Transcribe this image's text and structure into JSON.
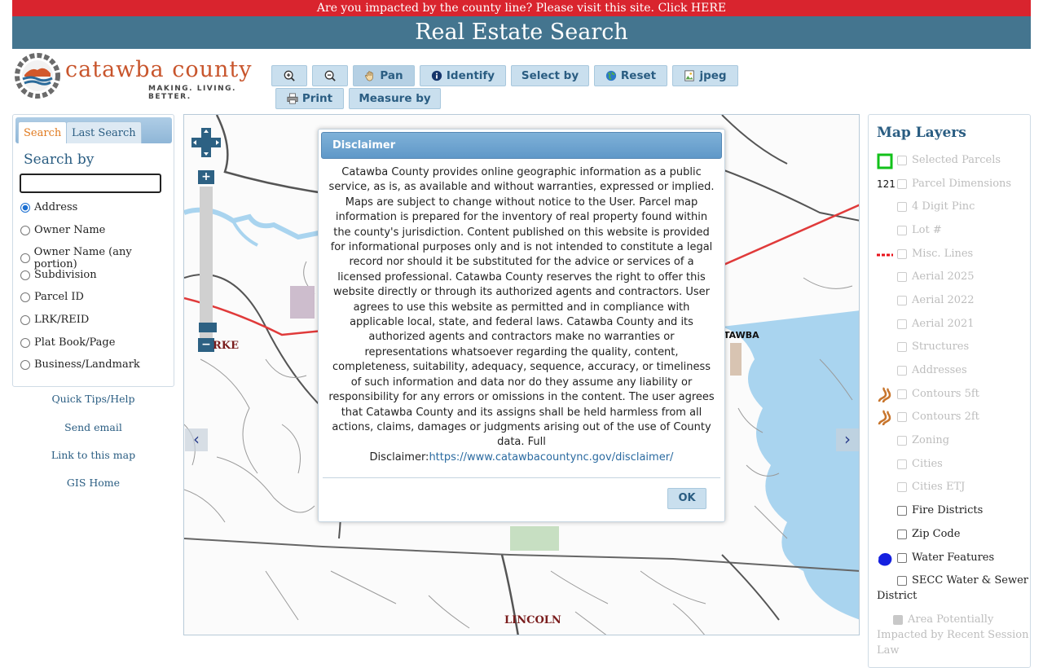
{
  "banner": {
    "text": "Are you impacted by the county line?   Please visit this site.   Click ",
    "link": "HERE"
  },
  "page_title": "Real Estate Search",
  "logo": {
    "name": "catawba county",
    "tagline": "MAKING. LIVING. BETTER."
  },
  "toolbar": {
    "zoom_in": "",
    "zoom_out": "",
    "pan": "Pan",
    "identify": "Identify",
    "select_by": "Select by",
    "reset": "Reset",
    "jpeg": "jpeg",
    "print": "Print",
    "measure_by": "Measure by"
  },
  "search_panel": {
    "tabs": [
      "Search",
      "Last Search"
    ],
    "heading": "Search by",
    "input_value": "",
    "options": [
      "Address",
      "Owner Name",
      "Owner Name (any portion)",
      "Subdivision",
      "Parcel ID",
      "LRK/REID",
      "Plat Book/Page",
      "Business/Landmark"
    ],
    "selected": "Address"
  },
  "links": [
    "Quick Tips/Help",
    "Send email",
    "Link to this map",
    "GIS Home"
  ],
  "map": {
    "labels": [
      "RKE",
      "LINCOLN",
      "TAWBA"
    ],
    "zoom_plus": "+",
    "zoom_minus": "−",
    "arrow_left": "‹",
    "arrow_right": "›",
    "colors": {
      "water": "#a9d4ef",
      "road": "#555555",
      "boundary": "#e03a3a"
    }
  },
  "dialog": {
    "title": "Disclaimer",
    "body": "Catawba County provides online geographic information as a public service, as is, as available and without warranties, expressed or implied. Maps are subject to change without notice to the User. Parcel map information is prepared for the inventory of real property found within the county's jurisdiction. Content published on this website is provided for informational purposes only and is not intended to constitute a legal record nor should it be substituted for the advice or services of a licensed professional. Catawba County reserves the right to offer this website directly or through its authorized agents and contractors. User agrees to use this website as permitted and in compliance with applicable local, state, and federal laws. Catawba County and its authorized agents and contractors make no warranties or representations whatsoever regarding the quality, content, completeness, suitability, adequacy, sequence, accuracy, or timeliness of such information and data nor do they assume any liability or responsibility for any errors or omissions in the content. The user agrees that Catawba County and its assigns shall be held harmless from all actions, claims, damages or judgments arising out of the use of County data. Full",
    "link_prefix": "Disclaimer:",
    "link_url": "https://www.catawbacountync.gov/disclaimer/",
    "ok_label": "OK"
  },
  "layers_panel": {
    "title": "Map Layers",
    "parcel_dim_symbol": "121",
    "layers": [
      {
        "label": "Selected Parcels",
        "enabled": false,
        "checked": false
      },
      {
        "label": "Parcel Dimensions",
        "enabled": false,
        "checked": false
      },
      {
        "label": "4 Digit Pinc",
        "enabled": false,
        "checked": false
      },
      {
        "label": "Lot #",
        "enabled": false,
        "checked": false
      },
      {
        "label": "Misc. Lines",
        "enabled": false,
        "checked": false
      },
      {
        "label": "Aerial 2025",
        "enabled": false,
        "checked": false
      },
      {
        "label": "Aerial 2022",
        "enabled": false,
        "checked": false
      },
      {
        "label": "Aerial 2021",
        "enabled": false,
        "checked": false
      },
      {
        "label": "Structures",
        "enabled": false,
        "checked": false
      },
      {
        "label": "Addresses",
        "enabled": false,
        "checked": false
      },
      {
        "label": "Contours 5ft",
        "enabled": false,
        "checked": false
      },
      {
        "label": "Contours 2ft",
        "enabled": false,
        "checked": false
      },
      {
        "label": "Zoning",
        "enabled": false,
        "checked": false
      },
      {
        "label": "Cities",
        "enabled": false,
        "checked": false
      },
      {
        "label": "Cities ETJ",
        "enabled": false,
        "checked": false
      },
      {
        "label": "Fire Districts",
        "enabled": true,
        "checked": false
      },
      {
        "label": "Zip Code",
        "enabled": true,
        "checked": false
      },
      {
        "label": "Water Features",
        "enabled": true,
        "checked": false
      },
      {
        "label": "SECC Water & Sewer",
        "label2": "District",
        "enabled": true,
        "checked": false
      },
      {
        "label": "Area Potentially",
        "label2": "Impacted by Recent Session",
        "label3": "Law",
        "enabled": false,
        "checked": true
      }
    ]
  }
}
